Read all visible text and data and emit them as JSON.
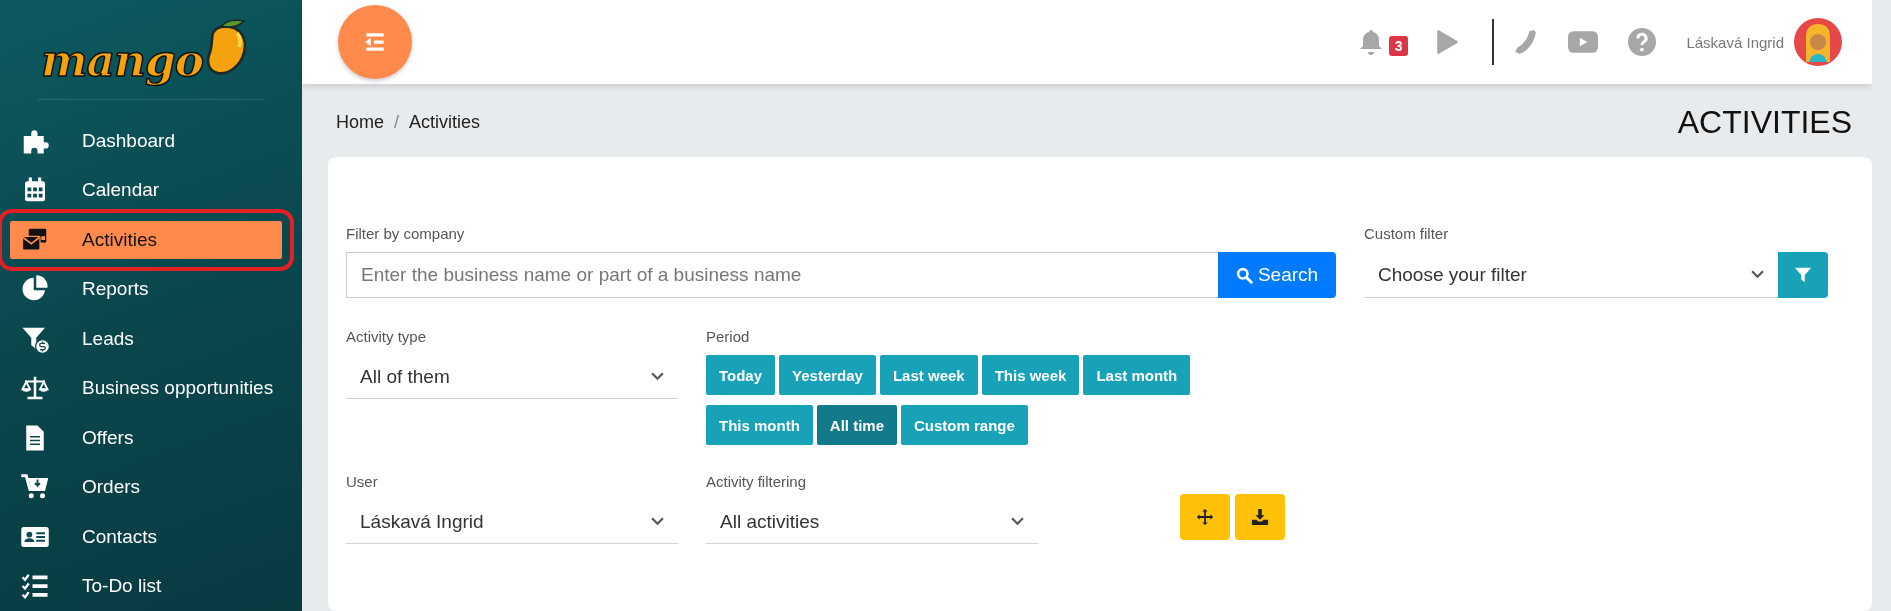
{
  "sidebar": {
    "logo": "mango",
    "items": [
      {
        "label": "Dashboard",
        "selected": false,
        "outlined": false
      },
      {
        "label": "Calendar",
        "selected": false,
        "outlined": false
      },
      {
        "label": "Activities",
        "selected": true,
        "outlined": true
      },
      {
        "label": "Reports",
        "selected": false,
        "outlined": false
      },
      {
        "label": "Leads",
        "selected": false,
        "outlined": false
      },
      {
        "label": "Business opportunities",
        "selected": false,
        "outlined": false
      },
      {
        "label": "Offers",
        "selected": false,
        "outlined": false
      },
      {
        "label": "Orders",
        "selected": false,
        "outlined": false
      },
      {
        "label": "Contacts",
        "selected": false,
        "outlined": false
      },
      {
        "label": "To-Do list",
        "selected": false,
        "outlined": false
      }
    ]
  },
  "topbar": {
    "notification_count": "3",
    "user_name": "Láskavá Ingrid"
  },
  "breadcrumb": {
    "items": [
      "Home",
      "Activities"
    ],
    "separator": "/"
  },
  "page_title": "ACTIVITIES",
  "filters": {
    "company": {
      "label": "Filter by company",
      "placeholder": "Enter the business name or part of a business name",
      "button": "Search"
    },
    "custom_filter": {
      "label": "Custom filter",
      "value": "Choose your filter"
    },
    "activity_type": {
      "label": "Activity type",
      "value": "All of them"
    },
    "period": {
      "label": "Period",
      "options": [
        {
          "label": "Today",
          "selected": false
        },
        {
          "label": "Yesterday",
          "selected": false
        },
        {
          "label": "Last week",
          "selected": false
        },
        {
          "label": "This week",
          "selected": false
        },
        {
          "label": "Last month",
          "selected": false
        },
        {
          "label": "This month",
          "selected": false
        },
        {
          "label": "All time",
          "selected": true
        },
        {
          "label": "Custom range",
          "selected": false
        }
      ]
    },
    "user": {
      "label": "User",
      "value": "Láskavá Ingrid"
    },
    "activity_filtering": {
      "label": "Activity filtering",
      "value": "All activities"
    }
  }
}
